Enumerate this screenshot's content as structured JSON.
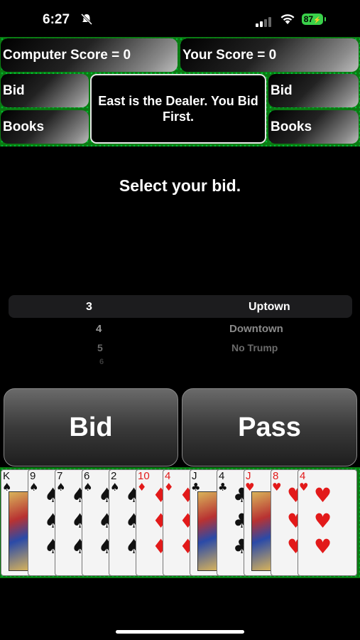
{
  "status_bar": {
    "time": "6:27",
    "battery": "87"
  },
  "scoreboard": {
    "computer_score": "Computer Score = 0",
    "your_score": "Your Score = 0",
    "left_bid": "Bid",
    "right_bid": "Bid",
    "left_books": "Books",
    "right_books": "Books",
    "message": "East is the Dealer. You Bid First."
  },
  "prompt": "Select your bid.",
  "picker": {
    "numbers": [
      "3",
      "4",
      "5",
      "6"
    ],
    "modes": [
      "Uptown",
      "Downtown",
      "No Trump"
    ],
    "selected_number": "3",
    "selected_mode": "Uptown"
  },
  "buttons": {
    "bid": "Bid",
    "pass": "Pass"
  },
  "hand": [
    {
      "rank": "K",
      "suit": "♠",
      "color": "black"
    },
    {
      "rank": "9",
      "suit": "♠",
      "color": "black"
    },
    {
      "rank": "7",
      "suit": "♠",
      "color": "black"
    },
    {
      "rank": "6",
      "suit": "♠",
      "color": "black"
    },
    {
      "rank": "2",
      "suit": "♠",
      "color": "black"
    },
    {
      "rank": "10",
      "suit": "♦",
      "color": "red"
    },
    {
      "rank": "4",
      "suit": "♦",
      "color": "red"
    },
    {
      "rank": "J",
      "suit": "♣",
      "color": "black"
    },
    {
      "rank": "4",
      "suit": "♣",
      "color": "black"
    },
    {
      "rank": "J",
      "suit": "♥",
      "color": "red"
    },
    {
      "rank": "8",
      "suit": "♥",
      "color": "red"
    },
    {
      "rank": "4",
      "suit": "♥",
      "color": "red"
    }
  ]
}
